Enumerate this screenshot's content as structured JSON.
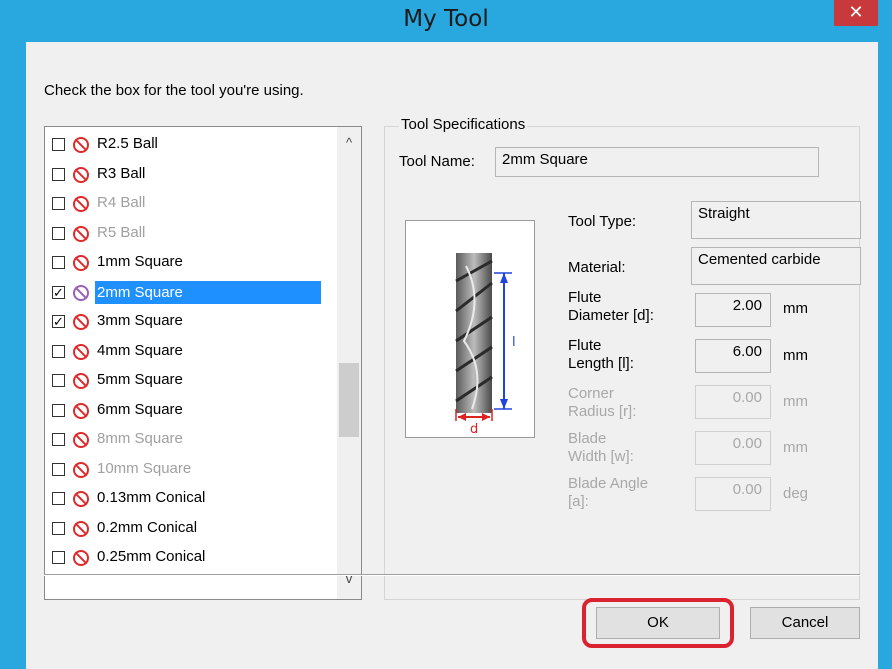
{
  "window": {
    "title": "My Tool",
    "close_symbol": "✕"
  },
  "instruction": "Check the box for the tool you're using.",
  "tool_list": {
    "items": [
      {
        "label": "R2.5 Ball",
        "checked": false,
        "disabled": false,
        "selected": false,
        "icon": "prohibited-icon"
      },
      {
        "label": "R3 Ball",
        "checked": false,
        "disabled": false,
        "selected": false,
        "icon": "prohibited-icon"
      },
      {
        "label": "R4 Ball",
        "checked": false,
        "disabled": true,
        "selected": false,
        "icon": "prohibited-icon"
      },
      {
        "label": "R5 Ball",
        "checked": false,
        "disabled": true,
        "selected": false,
        "icon": "prohibited-icon"
      },
      {
        "label": "1mm Square",
        "checked": false,
        "disabled": false,
        "selected": false,
        "icon": "prohibited-icon"
      },
      {
        "label": "2mm Square",
        "checked": true,
        "disabled": false,
        "selected": true,
        "icon": "prohibited-icon"
      },
      {
        "label": "3mm Square",
        "checked": true,
        "disabled": false,
        "selected": false,
        "icon": "prohibited-icon"
      },
      {
        "label": "4mm Square",
        "checked": false,
        "disabled": false,
        "selected": false,
        "icon": "prohibited-icon"
      },
      {
        "label": "5mm Square",
        "checked": false,
        "disabled": false,
        "selected": false,
        "icon": "prohibited-icon"
      },
      {
        "label": "6mm Square",
        "checked": false,
        "disabled": false,
        "selected": false,
        "icon": "prohibited-icon"
      },
      {
        "label": "8mm Square",
        "checked": false,
        "disabled": true,
        "selected": false,
        "icon": "prohibited-icon"
      },
      {
        "label": "10mm Square",
        "checked": false,
        "disabled": true,
        "selected": false,
        "icon": "prohibited-icon"
      },
      {
        "label": "0.13mm Conical",
        "checked": false,
        "disabled": false,
        "selected": false,
        "icon": "prohibited-icon"
      },
      {
        "label": "0.2mm Conical",
        "checked": false,
        "disabled": false,
        "selected": false,
        "icon": "prohibited-icon"
      },
      {
        "label": "0.25mm Conical",
        "checked": false,
        "disabled": false,
        "selected": false,
        "icon": "prohibited-icon"
      }
    ],
    "check_mark": "✓",
    "scroll_up_symbol": "^",
    "scroll_down_symbol": "v"
  },
  "specs": {
    "legend": "Tool Specifications",
    "tool_name_label": "Tool Name:",
    "tool_name_value": "2mm Square",
    "tool_type_label": "Tool Type:",
    "tool_type_value": "Straight",
    "material_label": "Material:",
    "material_value": "Cemented carbide",
    "flute_diameter_label": "Flute\nDiameter [d]:",
    "flute_diameter_value": "2.00",
    "flute_diameter_unit": "mm",
    "flute_length_label": "Flute\nLength [l]:",
    "flute_length_value": "6.00",
    "flute_length_unit": "mm",
    "corner_radius_label": "Corner\nRadius [r]:",
    "corner_radius_value": "0.00",
    "corner_radius_unit": "mm",
    "blade_width_label": "Blade\nWidth [w]:",
    "blade_width_value": "0.00",
    "blade_width_unit": "mm",
    "blade_angle_label": "Blade Angle\n[a]:",
    "blade_angle_value": "0.00",
    "blade_angle_unit": "deg",
    "diagram_length_letter": "l",
    "diagram_diameter_letter": "d"
  },
  "buttons": {
    "ok_label": "OK",
    "cancel_label": "Cancel"
  },
  "colors": {
    "titlebar": "#29a8e0",
    "close_button": "#c7393a",
    "selection": "#1e90ff",
    "highlight": "#d9232f"
  }
}
